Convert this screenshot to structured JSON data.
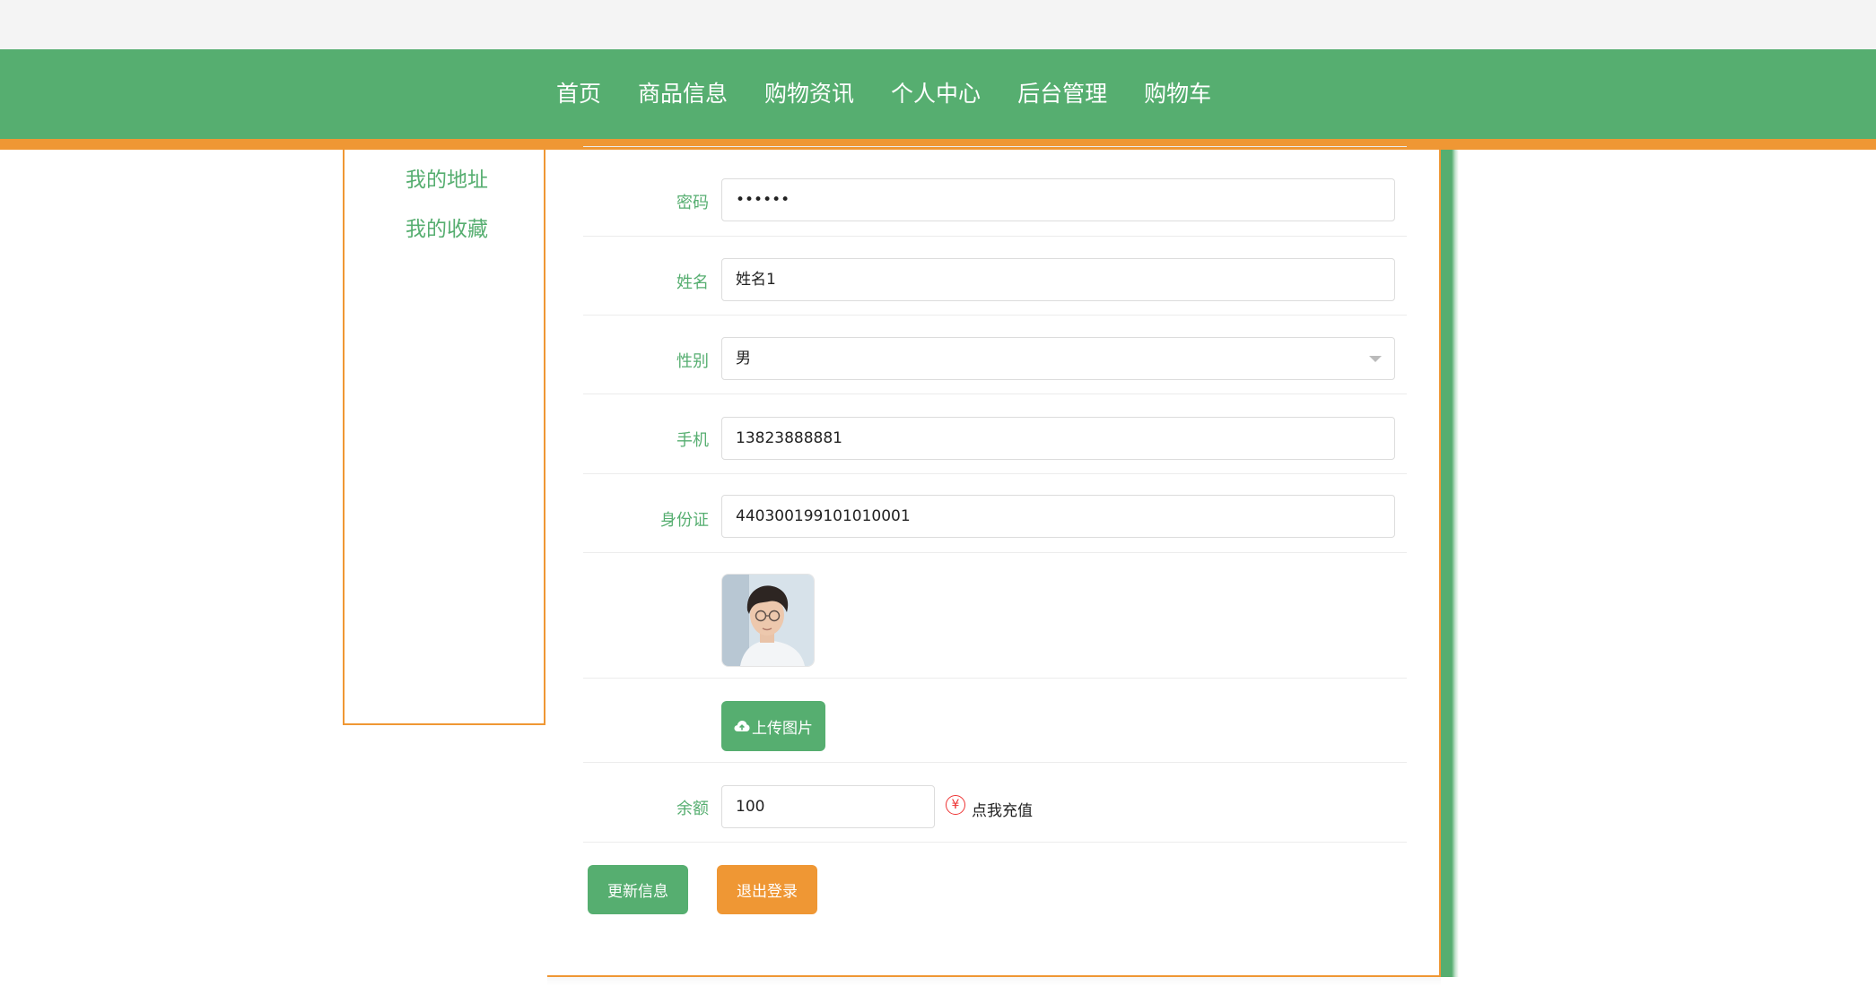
{
  "nav": {
    "items": [
      "首页",
      "商品信息",
      "购物资讯",
      "个人中心",
      "后台管理",
      "购物车"
    ]
  },
  "sidebar": {
    "items": [
      "我的地址",
      "我的收藏"
    ]
  },
  "form": {
    "password": {
      "label": "密码",
      "value": "••••••"
    },
    "name": {
      "label": "姓名",
      "value": "姓名1"
    },
    "gender": {
      "label": "性别",
      "value": "男"
    },
    "phone": {
      "label": "手机",
      "value": "13823888881"
    },
    "id_card": {
      "label": "身份证",
      "value": "440300199101010001"
    },
    "upload_label": "上传图片",
    "balance": {
      "label": "余额",
      "value": "100",
      "recharge_label": "点我充值",
      "currency_symbol": "¥"
    }
  },
  "actions": {
    "update_label": "更新信息",
    "logout_label": "退出登录"
  },
  "colors": {
    "primary_green": "#56ae70",
    "accent_orange": "#ef9734"
  },
  "icons": [
    "cloud-upload-icon",
    "yen-icon",
    "chevron-down-icon"
  ]
}
